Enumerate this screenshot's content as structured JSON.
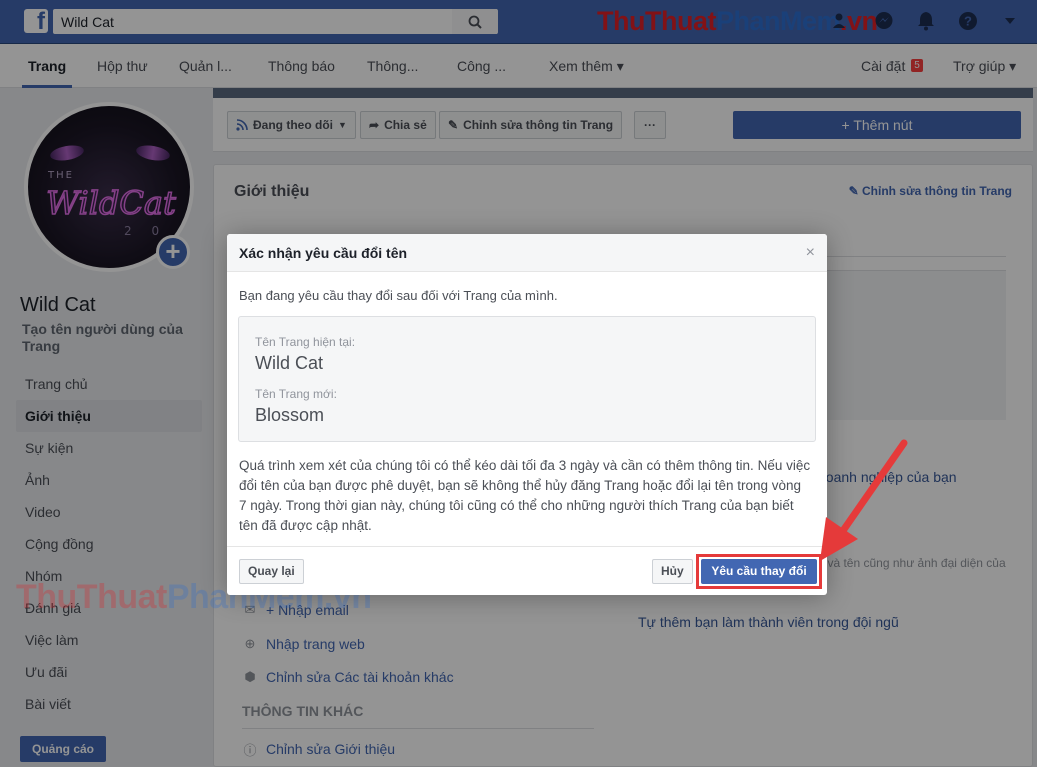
{
  "search": {
    "value": "Wild Cat"
  },
  "watermark": {
    "part1": "ThuThuat",
    "part2": "PhanMem",
    "part3": ".vn"
  },
  "watermark_mid": {
    "part1": "ThuThuat",
    "part2": "PhanMem.vn"
  },
  "top_icons": [
    "friends-icon",
    "messenger-icon",
    "notifications-icon",
    "help-icon",
    "dropdown-icon"
  ],
  "page_nav": {
    "tabs": [
      {
        "label": "Trang"
      },
      {
        "label": "Hộp thư"
      },
      {
        "label": "Quản l..."
      },
      {
        "label": "Thông báo"
      },
      {
        "label": "Thông..."
      },
      {
        "label": "Công ..."
      },
      {
        "label": "Xem thêm ▾"
      }
    ],
    "settings_label": "Cài đặt",
    "settings_badge": "5",
    "help_label": "Trợ giúp ▾"
  },
  "profile": {
    "avatar_the": "THE",
    "avatar_logo": "WildCat",
    "avatar_num": "2 0",
    "page_name": "Wild Cat",
    "username_prompt": "Tạo tên người dùng của Trang"
  },
  "left_nav": [
    {
      "label": "Trang chủ"
    },
    {
      "label": "Giới thiệu"
    },
    {
      "label": "Sự kiện"
    },
    {
      "label": "Ảnh"
    },
    {
      "label": "Video"
    },
    {
      "label": "Cộng đồng"
    },
    {
      "label": "Nhóm"
    },
    {
      "label": "Đánh giá"
    },
    {
      "label": "Việc làm"
    },
    {
      "label": "Ưu đãi"
    },
    {
      "label": "Bài viết"
    }
  ],
  "ad_button": "Quảng cáo",
  "action_bar": {
    "follow": "Đang theo dõi",
    "share": "Chia sẻ",
    "edit": "Chỉnh sửa thông tin Trang",
    "more": "···",
    "add": "+ Thêm nút"
  },
  "intro": {
    "title": "Giới thiệu",
    "edit_link": "Chỉnh sửa thông tin Trang",
    "email": "+ Nhập email",
    "website": "Nhập trang web",
    "other_accounts": "Chỉnh sửa Các tài khoản khác",
    "more_info_head": "THÔNG TIN KHÁC",
    "edit_about": "Chỉnh sửa Giới thiệu",
    "right_business": "doanh nghiệp của bạn",
    "right_small": "Cat và đã chọn cho phép ... của họ và tên cũng như ảnh đại diện của họ được hiển thị trên Trang.",
    "right_team_link": "Tự thêm bạn làm thành viên trong đội ngũ",
    "right_bold": "t"
  },
  "dialog": {
    "title": "Xác nhận yêu cầu đổi tên",
    "close": "×",
    "intro": "Bạn đang yêu cầu thay đổi sau đối với Trang của mình.",
    "current_label": "Tên Trang hiện tại:",
    "current_value": "Wild Cat",
    "new_label": "Tên Trang mới:",
    "new_value": "Blossom",
    "body": "Quá trình xem xét của chúng tôi có thể kéo dài tối đa 3 ngày và cần có thêm thông tin. Nếu việc đổi tên của bạn được phê duyệt, bạn sẽ không thể hủy đăng Trang hoặc đổi lại tên trong vòng 7 ngày. Trong thời gian này, chúng tôi cũng có thể cho những người thích Trang của bạn biết tên đã được cập nhật.",
    "back": "Quay lại",
    "cancel": "Hủy",
    "confirm": "Yêu cầu thay đổi"
  },
  "colors": {
    "brand": "#4267b2",
    "highlight": "#e53a3a"
  }
}
